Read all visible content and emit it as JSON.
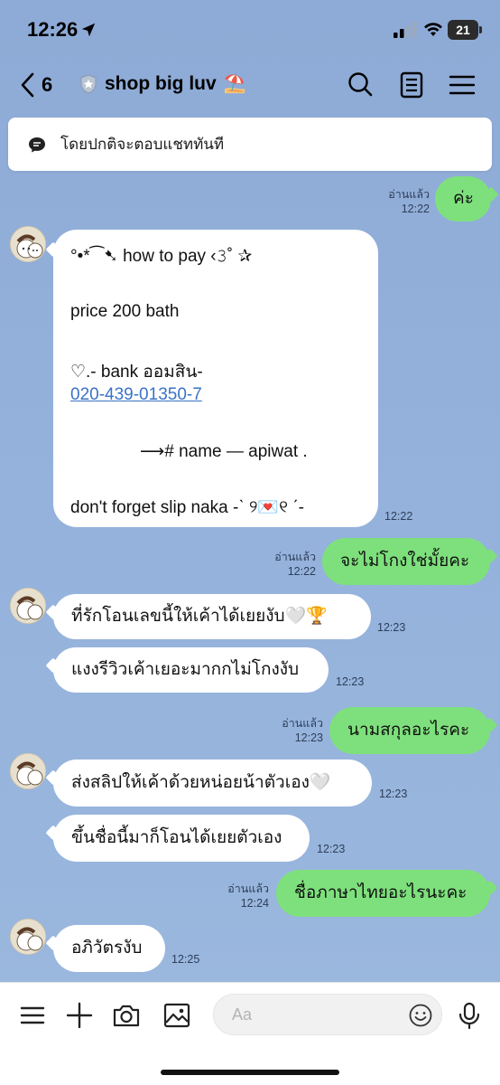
{
  "status": {
    "time": "12:26",
    "battery": "21"
  },
  "header": {
    "back_count": "6",
    "title": "shop big luv",
    "title_emoji": "⛱️"
  },
  "notice": {
    "text": "โดยปกติจะตอบแชททันที"
  },
  "messages": [
    {
      "id": "m1",
      "side": "out",
      "text": "ค่ะ",
      "read": "อ่านแล้ว",
      "time": "12:22"
    },
    {
      "id": "m2",
      "side": "in",
      "lines": [
        "°•*⁀➷  how to pay ‹𝟹˚ ✰",
        "price 200 bath",
        "♡.- bank ออมสิน-",
        "020-439-01350-7",
        "⟶# name — apiwat .",
        "don't  forget  slip naka -ˋ ୨💌୧ ˊ-"
      ],
      "time": "12:22"
    },
    {
      "id": "m3",
      "side": "out",
      "text": "จะไม่โกงใช่มั้ยคะ",
      "read": "อ่านแล้ว",
      "time": "12:22"
    },
    {
      "id": "m4",
      "side": "in",
      "text": "ที่รักโอนเลขนี้ให้เค้าได้เยยงับ🤍🏆",
      "time": "12:23"
    },
    {
      "id": "m5",
      "side": "in",
      "text": "แงงรีวิวเค้าเยอะมากกไม่โกงงับ",
      "time": "12:23"
    },
    {
      "id": "m6",
      "side": "out",
      "text": "นามสกุลอะไรคะ",
      "read": "อ่านแล้ว",
      "time": "12:23"
    },
    {
      "id": "m7",
      "side": "in",
      "text": "ส่งสลิปให้เค้าด้วยหน่อยน้าตัวเอง🤍",
      "time": "12:23"
    },
    {
      "id": "m8",
      "side": "in",
      "text": "ขึ้นชื่อนี้มาก็โอนได้เยยตัวเอง",
      "time": "12:23"
    },
    {
      "id": "m9",
      "side": "out",
      "text": "ชื่อภาษาไทยอะไรนะคะ",
      "read": "อ่านแล้ว",
      "time": "12:24"
    },
    {
      "id": "m10",
      "side": "in",
      "text": "อภิวัตรงับ",
      "time": "12:25"
    }
  ],
  "composer": {
    "placeholder": "Aa"
  },
  "icons": [
    "location-arrow-icon",
    "signal-icon",
    "wifi-icon",
    "battery-icon",
    "back-chevron-icon",
    "shield-icon",
    "search-icon",
    "notes-icon",
    "menu-icon",
    "chat-bubble-icon",
    "list-icon",
    "plus-icon",
    "camera-icon",
    "image-icon",
    "emoji-icon",
    "microphone-icon"
  ],
  "colors": {
    "background": "#8faed6",
    "outgoing_bubble": "#7ee07c",
    "incoming_bubble": "#ffffff",
    "link": "#3a72c8"
  }
}
